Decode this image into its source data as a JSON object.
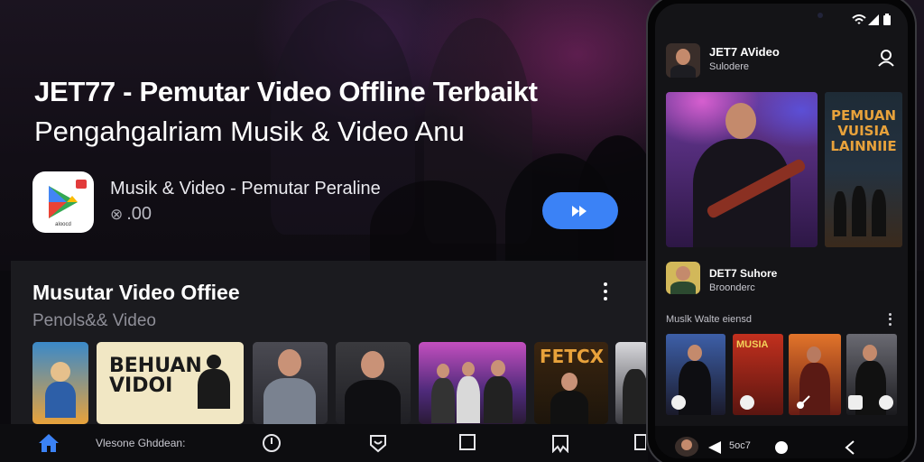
{
  "hero": {
    "title": "JET77 - Pemutar Video Offline Terbaikt",
    "subtitle": "Pengahgalriam Musik & Video Anu",
    "app": {
      "icon": "play-store-icon",
      "icon_caption": "aloocd",
      "name": "Musik & Video - Pemutar Peraline",
      "rating": ".00"
    },
    "play_button": {
      "icon": "fast-forward-icon",
      "color": "#3b82f6"
    }
  },
  "panel": {
    "title": "Musutar Video Offiee",
    "subtitle": "Penols&& Video",
    "thumbnails": [
      {
        "kind": "cartoon"
      },
      {
        "kind": "text-poster",
        "text": "BEHUAN VIDOI"
      },
      {
        "kind": "portrait"
      },
      {
        "kind": "portrait-tshirt"
      },
      {
        "kind": "band"
      },
      {
        "kind": "movie-poster",
        "text": "FETCX"
      },
      {
        "kind": "partial"
      }
    ]
  },
  "bottom_nav": {
    "items": [
      "home-icon",
      "clock-icon",
      "heart-shield-icon",
      "square-icon",
      "bookmark-icon"
    ],
    "label": "Vlesone Ghddean:"
  },
  "phone": {
    "header_title": "JET7 AVideo",
    "header_subtitle": "Sulodere",
    "featured_poster_text": "PEMUAN VUISIA LAINNIIE",
    "channel_title": "DET7 Suhore",
    "channel_subtitle": "Broonderc",
    "section_label": "Muslk Walte",
    "section_tail": "eiensd",
    "nav_label": "5oc7",
    "thumb_text": "MUSIA"
  },
  "colors": {
    "accent": "#3b82f6",
    "panel_bg": "#1b1b1f",
    "nav_active": "#3b82f6"
  }
}
